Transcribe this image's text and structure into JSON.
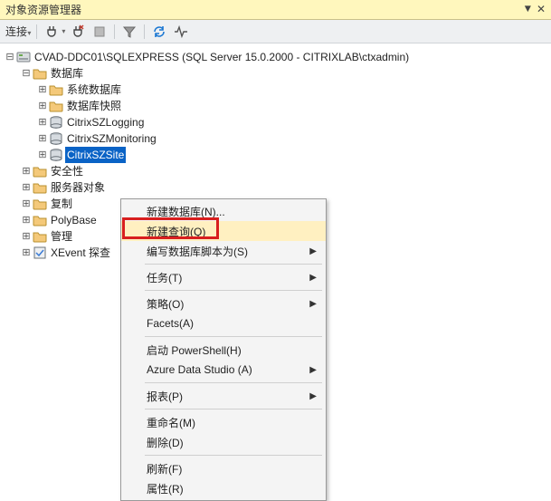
{
  "titlebar": {
    "title": "对象资源管理器",
    "pin": "⇩",
    "close": "✕"
  },
  "toolbar": {
    "connect_label": "连接",
    "dropdown": "▾"
  },
  "tree": {
    "server": {
      "expander": "⊟",
      "label": "CVAD-DDC01\\SQLEXPRESS (SQL Server 15.0.2000 - CITRIXLAB\\ctxadmin)"
    },
    "databases": {
      "expander": "⊟",
      "label": "数据库",
      "children": [
        {
          "expander": "⊞",
          "label": "系统数据库",
          "icon": "folder"
        },
        {
          "expander": "⊞",
          "label": "数据库快照",
          "icon": "folder"
        },
        {
          "expander": "⊞",
          "label": "CitrixSZLogging",
          "icon": "db"
        },
        {
          "expander": "⊞",
          "label": "CitrixSZMonitoring",
          "icon": "db"
        },
        {
          "expander": "⊞",
          "label": "CitrixSZSite",
          "icon": "db",
          "selected": true
        }
      ]
    },
    "siblings": [
      {
        "expander": "⊞",
        "label": "安全性",
        "icon": "folder"
      },
      {
        "expander": "⊞",
        "label": "服务器对象",
        "icon": "folder",
        "truncated": true,
        "display": "服务器对象"
      },
      {
        "expander": "⊞",
        "label": "复制",
        "icon": "folder"
      },
      {
        "expander": "⊞",
        "label": "PolyBase",
        "icon": "folder"
      },
      {
        "expander": "⊞",
        "label": "管理",
        "icon": "folder"
      },
      {
        "expander": "⊞",
        "label": "XEvent 探查",
        "icon": "xevent",
        "truncated": true,
        "display": "XEvent 探查"
      }
    ]
  },
  "contextmenu": {
    "items": [
      {
        "label": "新建数据库(N)...",
        "type": "item"
      },
      {
        "label": "新建查询(Q)",
        "type": "item",
        "highlight": true
      },
      {
        "label": "编写数据库脚本为(S)",
        "type": "submenu"
      },
      {
        "type": "sep"
      },
      {
        "label": "任务(T)",
        "type": "submenu"
      },
      {
        "type": "sep"
      },
      {
        "label": "策略(O)",
        "type": "submenu"
      },
      {
        "label": "Facets(A)",
        "type": "item"
      },
      {
        "type": "sep"
      },
      {
        "label": "启动 PowerShell(H)",
        "type": "item"
      },
      {
        "label": "Azure Data Studio (A)",
        "type": "submenu"
      },
      {
        "type": "sep"
      },
      {
        "label": "报表(P)",
        "type": "submenu"
      },
      {
        "type": "sep"
      },
      {
        "label": "重命名(M)",
        "type": "item"
      },
      {
        "label": "删除(D)",
        "type": "item"
      },
      {
        "type": "sep"
      },
      {
        "label": "刷新(F)",
        "type": "item"
      },
      {
        "label": "属性(R)",
        "type": "item"
      }
    ]
  }
}
